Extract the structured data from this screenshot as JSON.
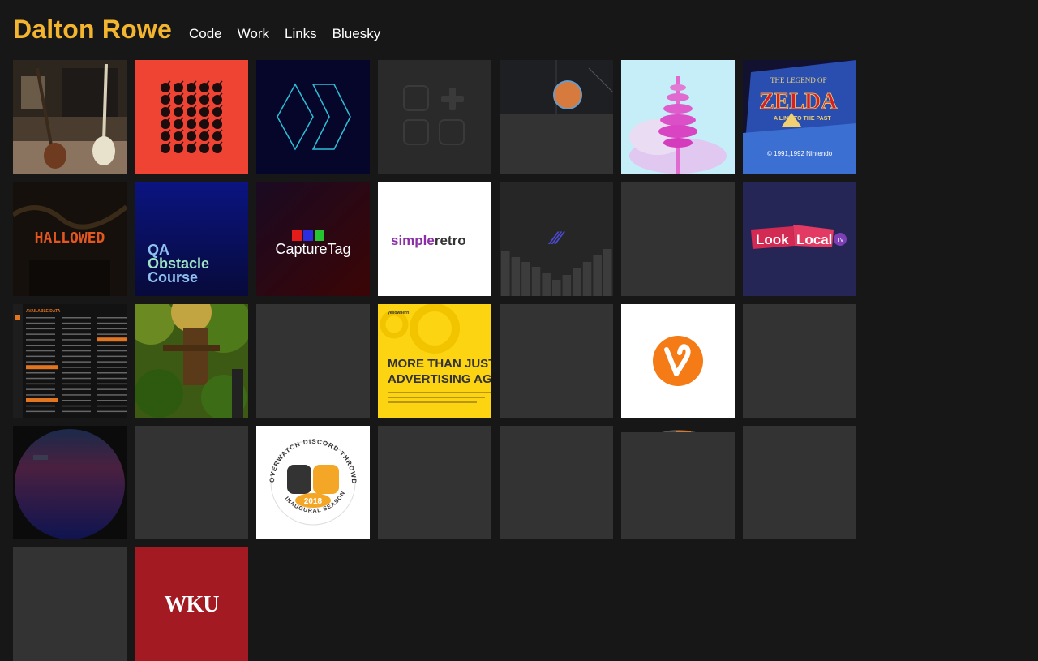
{
  "site": {
    "title": "Dalton Rowe",
    "nav": [
      "Code",
      "Work",
      "Links",
      "Bluesky"
    ],
    "accent": "#f3b52f"
  },
  "tiles": {
    "hallowed": "HALLOWED",
    "qa": [
      "QA",
      "Obstacle",
      "Course"
    ],
    "capturetag": "CaptureTag",
    "simpleretro": [
      "simple",
      "retro"
    ],
    "looklocal": [
      "Look",
      "Local",
      "TV"
    ],
    "yellow_top": "yellowberri",
    "yellow_head": [
      "MORE THAN JUST",
      "ADVERTISING AG"
    ],
    "overwatch_ring": "OVERWATCH DISCORD THROWDOWN",
    "overwatch_bottom": "INAUGURAL SEASON",
    "overwatch_year": "2018",
    "wku": "WKU",
    "zelda": [
      "THE LEGEND OF",
      "ZELDA",
      "A LINK TO THE PAST",
      "© 1991,1992 Nintendo"
    ],
    "panel_title": "AVAILABLE DATA"
  },
  "colors": {
    "placeholder": "#333333",
    "red_tile": "#ef4334",
    "wku_red": "#a31a22",
    "yellow_tile": "#fcd412",
    "looklocal_bg": "#252656"
  }
}
